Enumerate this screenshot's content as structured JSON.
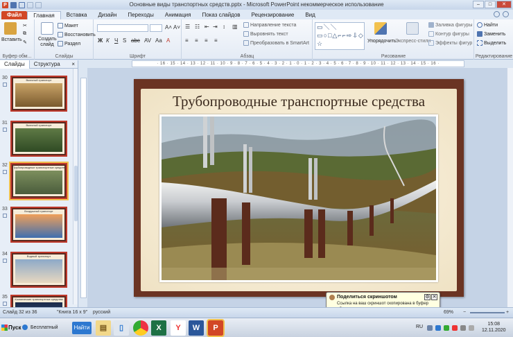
{
  "window": {
    "title": "Основные виды транспортных средств.pptx - Microsoft PowerPoint некоммерческое использование"
  },
  "ribbon_tabs": [
    "Файл",
    "Главная",
    "Вставка",
    "Дизайн",
    "Переходы",
    "Анимация",
    "Показ слайдов",
    "Рецензирование",
    "Вид"
  ],
  "ribbon": {
    "clipboard": {
      "paste": "Вставить",
      "label": "Буфер обм..."
    },
    "slides": {
      "new_slide": "Создать слайд",
      "layout": "Макет",
      "reset": "Восстановить",
      "section": "Раздел",
      "label": "Слайды"
    },
    "font": {
      "label": "Шрифт"
    },
    "paragraph": {
      "text_direction": "Направление текста",
      "align_text": "Выровнять текст",
      "smartart": "Преобразовать в SmartArt",
      "label": "Абзац"
    },
    "drawing": {
      "arrange": "Упорядочить",
      "quick_styles": "Экспресс-стили",
      "shape_fill": "Заливка фигуры",
      "shape_outline": "Контур фигуры",
      "shape_effects": "Эффекты фигур",
      "label": "Рисование"
    },
    "editing": {
      "find": "Найти",
      "replace": "Заменить",
      "select": "Выделить",
      "label": "Редактирование"
    }
  },
  "ruler": {
    "marks": "· 16 · 15 · 14 · 13 · 12 · 11 · 10 · 9 · 8 · 7 · 6 · 5 · 4 · 3 · 2 · 1 · 0 · 1 · 2 · 3 · 4 · 5 · 6 · 7 · 8 · 9 · 10 · 11 · 12 · 13 · 14 · 15 · 16 ·"
  },
  "panel": {
    "tabs": [
      "Слайды",
      "Структура"
    ],
    "close": "×",
    "thumbnails": [
      {
        "num": "30",
        "caption": "Вьючный транспорт",
        "colors": [
          "#c9a468",
          "#7a5a2e"
        ]
      },
      {
        "num": "31",
        "caption": "Вьючный транспорт",
        "colors": [
          "#5f7a46",
          "#2f4a24"
        ]
      },
      {
        "num": "32",
        "caption": "Трубопроводные транспортные средства",
        "colors": [
          "#7d8f5e",
          "#4a5c3c"
        ]
      },
      {
        "num": "33",
        "caption": "Воздушный транспорт",
        "colors": [
          "#f0a05a",
          "#3f6fb0"
        ]
      },
      {
        "num": "34",
        "caption": "Водный транспорт",
        "colors": [
          "#8da9c8",
          "#e8d8c0"
        ]
      },
      {
        "num": "35",
        "caption": "Космические транспортные средства",
        "colors": [
          "#1b2a4a",
          "#3a5a8a"
        ]
      }
    ]
  },
  "slide": {
    "title": "Трубопроводные транспортные средства"
  },
  "statusbar": {
    "slide_info": "Слайд 32 из 36",
    "theme": "\"Книга 16 х 9\"",
    "language": "русский",
    "zoom": "69%"
  },
  "balloon": {
    "title": "Поделиться скриншотом",
    "text": "Ссылка на ваш скриншот скопирована в буфер обмена."
  },
  "taskbar": {
    "start": "Пуск",
    "search_app": "Бесплатный арх...",
    "find_button": "Найти",
    "tray_lang": "RU",
    "time": "15:08",
    "date": "12.11.2020"
  }
}
